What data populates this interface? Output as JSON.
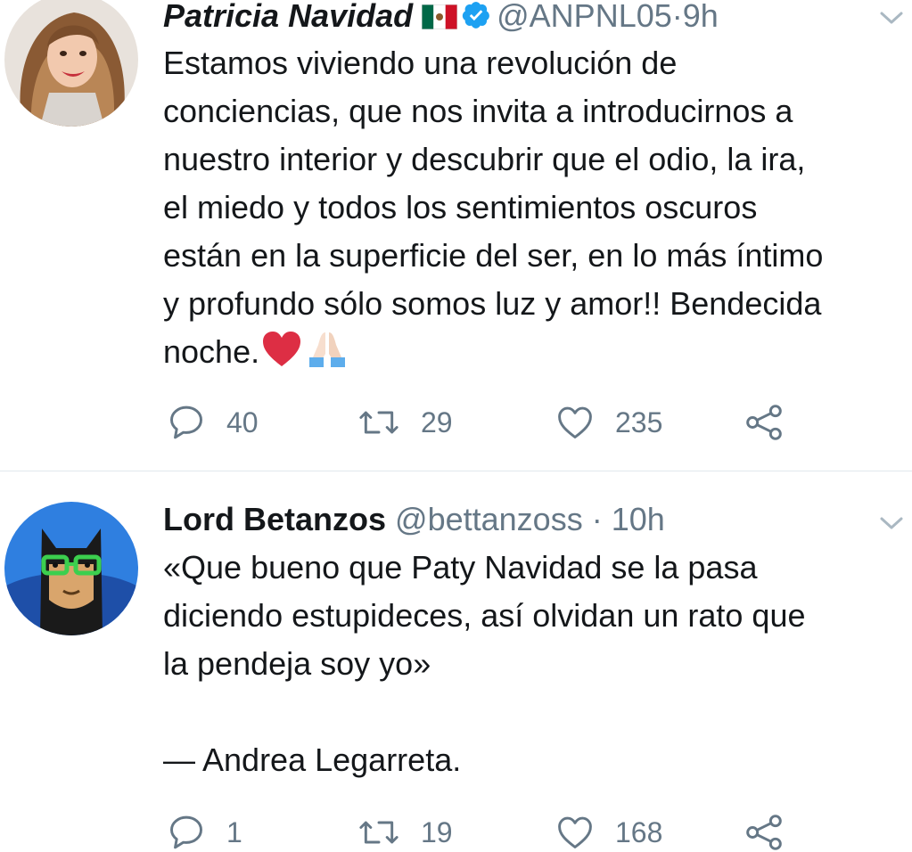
{
  "tweets": [
    {
      "name": "Patricia Navidad",
      "flag": "mexico-flag",
      "verified": true,
      "handle": "@ANPNL05",
      "separator": "·",
      "time": "9h",
      "text": "Estamos viviendo una revolución de\nconciencias, que nos invita a introducirnos a\nnuestro interior y descubrir que el odio, la ira,\nel miedo y todos los sentimientos oscuros\nestán en la superficie del ser, en lo más íntimo\ny profundo sólo somos luz y amor!! Bendecida\nnoche.",
      "emojis": [
        "red-heart",
        "folded-hands"
      ],
      "replies": "40",
      "retweets": "29",
      "likes": "235"
    },
    {
      "name": "Lord Betanzos",
      "handle": "@bettanzoss",
      "separator": "·",
      "time": "10h",
      "text": "«Que bueno que Paty Navidad se la pasa\ndiciendo estupideces, así olvidan un rato que\nla pendeja soy yo»\n\n— Andrea Legarreta.",
      "replies": "1",
      "retweets": "19",
      "likes": "168"
    }
  ],
  "icons": {
    "reply": "speech-bubble-icon",
    "retweet": "retweet-icon",
    "like": "heart-outline-icon",
    "share": "share-icon",
    "caret": "chevron-down-icon"
  },
  "colors": {
    "text": "#14171a",
    "muted": "#657786",
    "verified": "#1da1f2",
    "divider": "#e1e8ed",
    "heart": "#e0245e"
  }
}
